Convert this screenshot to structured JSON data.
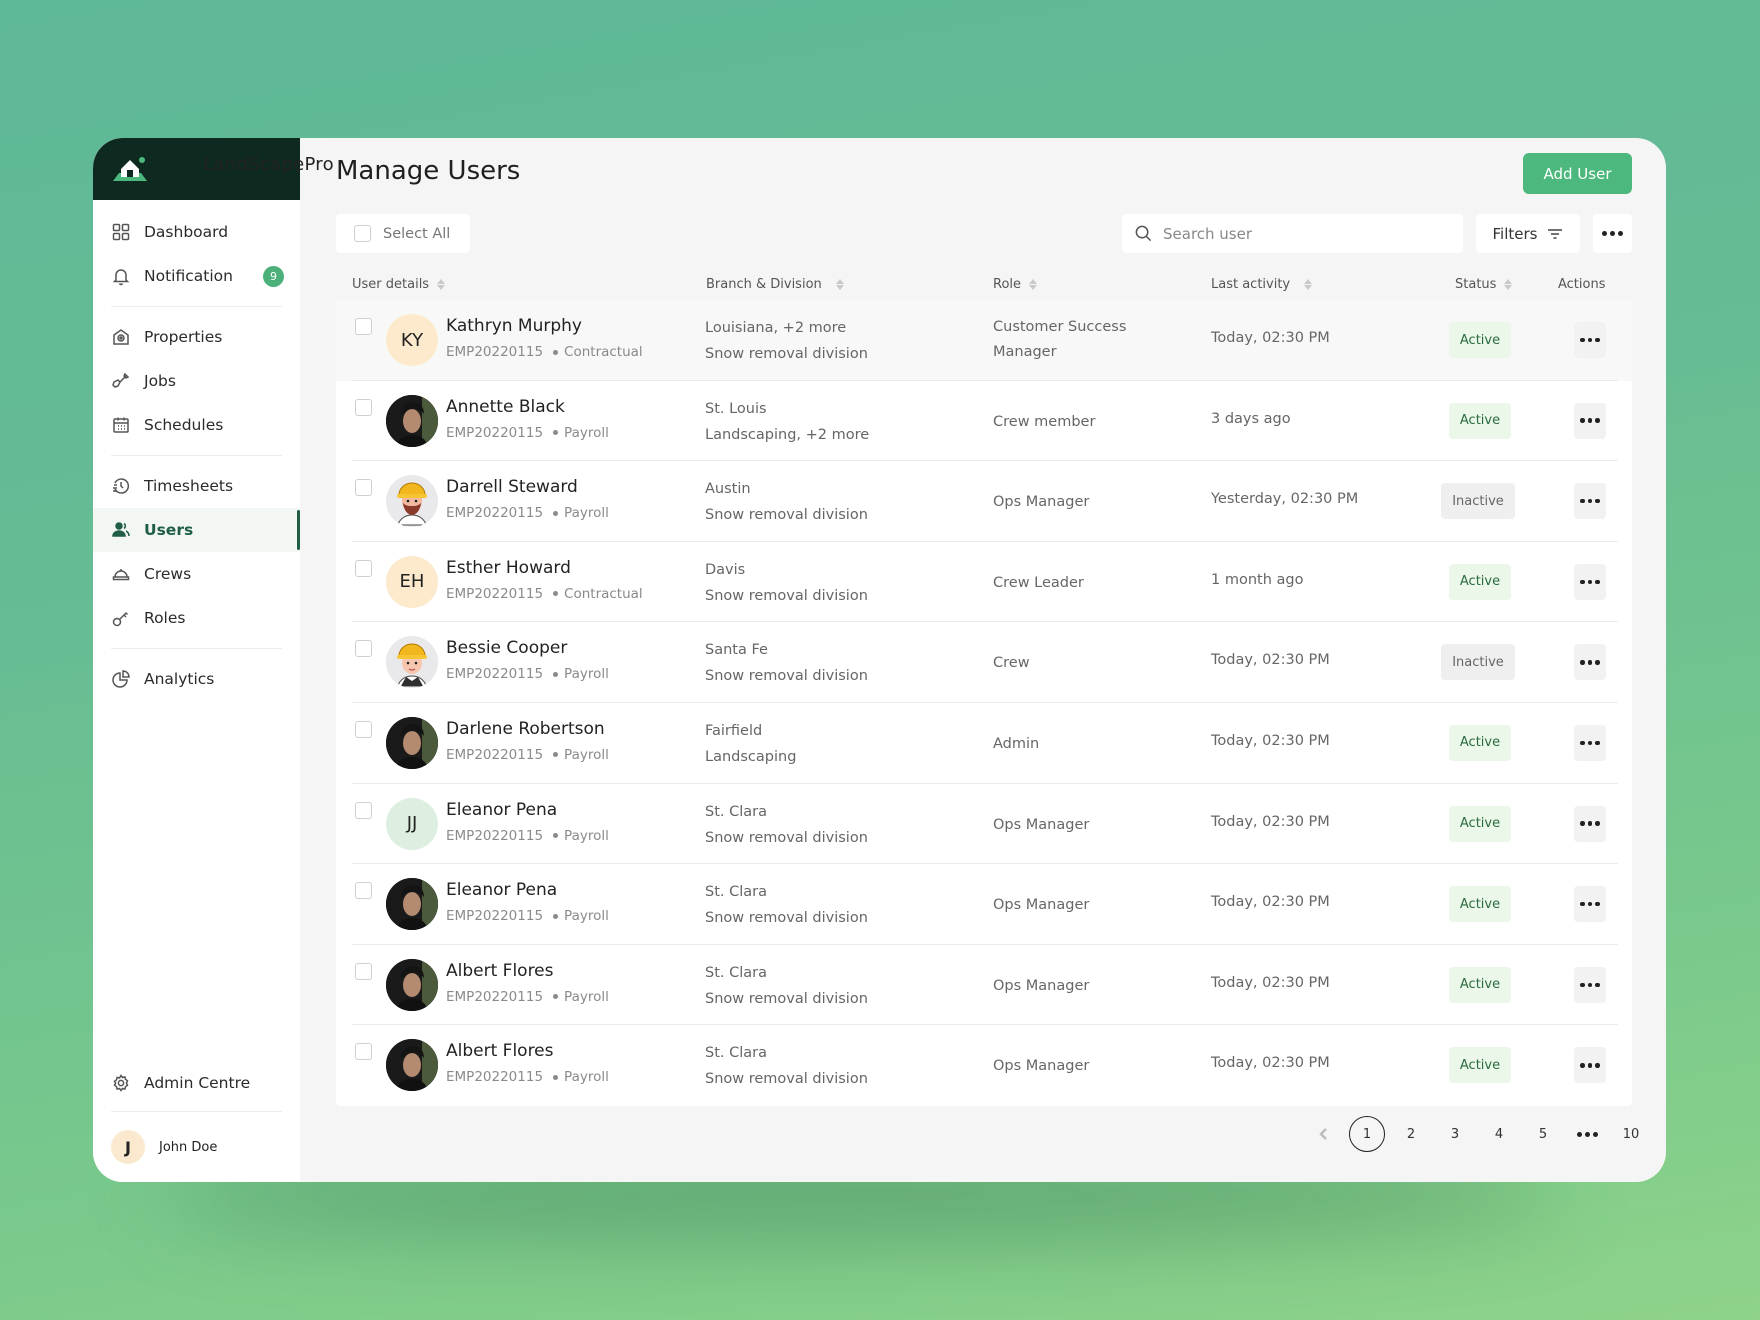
{
  "app": {
    "name": "LandScapePro"
  },
  "sidebar": {
    "items": [
      {
        "label": "Dashboard",
        "icon": "grid-icon"
      },
      {
        "label": "Notification",
        "icon": "bell-icon",
        "badge": "9"
      },
      {
        "label": "Properties",
        "icon": "property-icon"
      },
      {
        "label": "Jobs",
        "icon": "shovel-icon"
      },
      {
        "label": "Schedules",
        "icon": "calendar-icon"
      },
      {
        "label": "Timesheets",
        "icon": "clock-history-icon"
      },
      {
        "label": "Users",
        "icon": "users-icon",
        "active": true
      },
      {
        "label": "Crews",
        "icon": "hardhat-icon"
      },
      {
        "label": "Roles",
        "icon": "key-icon"
      },
      {
        "label": "Analytics",
        "icon": "pie-chart-icon"
      }
    ],
    "admin_label": "Admin Centre",
    "user": {
      "initial": "J",
      "name": "John Doe"
    }
  },
  "page": {
    "title": "Manage Users",
    "add_button": "Add User",
    "select_all": "Select All",
    "search_placeholder": "Search user",
    "filters_label": "Filters"
  },
  "table": {
    "columns": [
      "User details",
      "Branch & Division",
      "Role",
      "Last activity",
      "Status",
      "Actions"
    ],
    "rows": [
      {
        "avatar": "initials",
        "initials": "KY",
        "tone": "peach",
        "name": "Kathryn Murphy",
        "emp_id": "EMP20220115",
        "type": "Contractual",
        "branch": "Louisiana, +2 more",
        "division": "Snow removal division",
        "role_l1": "Customer Success",
        "role_l2": "Manager",
        "activity": "Today, 02:30 PM",
        "status": "Active"
      },
      {
        "avatar": "photo",
        "name": "Annette Black",
        "emp_id": "EMP20220115",
        "type": "Payroll",
        "branch": "St. Louis",
        "division": "Landscaping, +2 more",
        "role_l1": "Crew member",
        "role_l2": "",
        "activity": "3 days ago",
        "status": "Active"
      },
      {
        "avatar": "illustration-bearded",
        "name": "Darrell Steward",
        "emp_id": "EMP20220115",
        "type": "Payroll",
        "branch": "Austin",
        "division": "Snow removal division",
        "role_l1": "Ops Manager",
        "role_l2": "",
        "activity": "Yesterday, 02:30 PM",
        "status": "Inactive"
      },
      {
        "avatar": "initials",
        "initials": "EH",
        "tone": "peach",
        "name": "Esther Howard",
        "emp_id": "EMP20220115",
        "type": "Contractual",
        "branch": "Davis",
        "division": "Snow removal division",
        "role_l1": "Crew Leader",
        "role_l2": "",
        "activity": "1 month ago",
        "status": "Active"
      },
      {
        "avatar": "illustration",
        "name": "Bessie Cooper",
        "emp_id": "EMP20220115",
        "type": "Payroll",
        "branch": "Santa Fe",
        "division": "Snow removal division",
        "role_l1": "Crew",
        "role_l2": "",
        "activity": "Today, 02:30 PM",
        "status": "Inactive"
      },
      {
        "avatar": "photo",
        "name": "Darlene Robertson",
        "emp_id": "EMP20220115",
        "type": "Payroll",
        "branch": "Fairfield",
        "division": "Landscaping",
        "role_l1": "Admin",
        "role_l2": "",
        "activity": "Today, 02:30 PM",
        "status": "Active"
      },
      {
        "avatar": "initials",
        "initials": "JJ",
        "tone": "mint",
        "name": "Eleanor Pena",
        "emp_id": "EMP20220115",
        "type": "Payroll",
        "branch": "St. Clara",
        "division": "Snow removal division",
        "role_l1": "Ops Manager",
        "role_l2": "",
        "activity": "Today, 02:30 PM",
        "status": "Active"
      },
      {
        "avatar": "photo",
        "name": "Eleanor Pena",
        "emp_id": "EMP20220115",
        "type": "Payroll",
        "branch": "St. Clara",
        "division": "Snow removal division",
        "role_l1": "Ops Manager",
        "role_l2": "",
        "activity": "Today, 02:30 PM",
        "status": "Active"
      },
      {
        "avatar": "photo",
        "name": "Albert Flores",
        "emp_id": "EMP20220115",
        "type": "Payroll",
        "branch": "St. Clara",
        "division": "Snow removal division",
        "role_l1": "Ops Manager",
        "role_l2": "",
        "activity": "Today, 02:30 PM",
        "status": "Active"
      },
      {
        "avatar": "photo",
        "name": "Albert Flores",
        "emp_id": "EMP20220115",
        "type": "Payroll",
        "branch": "St. Clara",
        "division": "Snow removal division",
        "role_l1": "Ops Manager",
        "role_l2": "",
        "activity": "Today, 02:30 PM",
        "status": "Active"
      }
    ]
  },
  "pagination": {
    "pages": [
      "1",
      "2",
      "3",
      "4",
      "5",
      "…",
      "10"
    ],
    "current": "1"
  },
  "colors": {
    "brand_dark": "#0e2a20",
    "accent": "#4cb87d",
    "active_nav": "#1f5e45",
    "active_badge_bg": "#eaf7e9",
    "inactive_badge_bg": "#efefef"
  }
}
